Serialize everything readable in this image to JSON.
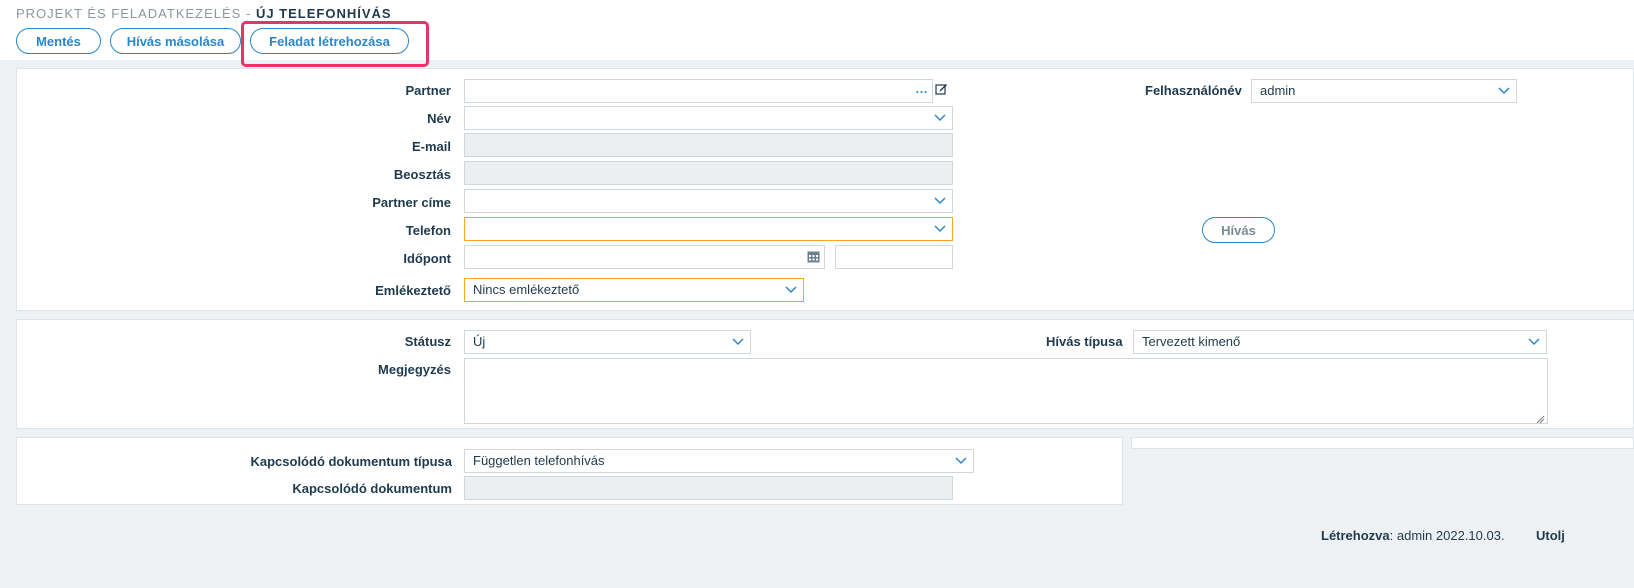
{
  "header": {
    "breadcrumb": "PROJEKT ÉS FELADATKEZELÉS -",
    "title": "ÚJ TELEFONHÍVÁS"
  },
  "toolbar": {
    "save_label": "Mentés",
    "copy_label": "Hívás másolása",
    "create_task_label": "Feladat létrehozása"
  },
  "form": {
    "partner_label": "Partner",
    "partner_value": "",
    "nev_label": "Név",
    "nev_value": "",
    "email_label": "E-mail",
    "email_value": "",
    "beosztas_label": "Beosztás",
    "beosztas_value": "",
    "partner_cime_label": "Partner címe",
    "partner_cime_value": "",
    "telefon_label": "Telefon",
    "telefon_value": "",
    "idopont_label": "Időpont",
    "idopont_date": "",
    "idopont_time": "",
    "emlekezteto_label": "Emlékeztető",
    "emlekezteto_value": "Nincs emlékeztető",
    "felhasznalonev_label": "Felhasználónév",
    "felhasznalonev_value": "admin",
    "hivas_button": "Hívás"
  },
  "status_section": {
    "statusz_label": "Státusz",
    "statusz_value": "Új",
    "hivas_tipusa_label": "Hívás típusa",
    "hivas_tipusa_value": "Tervezett kimenő",
    "megjegyzes_label": "Megjegyzés",
    "megjegyzes_value": ""
  },
  "related": {
    "doc_type_label": "Kapcsolódó dokumentum típusa",
    "doc_type_value": "Független telefonhívás",
    "doc_label": "Kapcsolódó dokumentum",
    "doc_value": ""
  },
  "footer": {
    "created_label": "Létrehozva",
    "created_value": "admin 2022.10.03.",
    "modified_label": "Utolj"
  },
  "colors": {
    "accent": "#2c86c9",
    "highlight": "#e8336a",
    "warning_border": "#f5a623"
  }
}
